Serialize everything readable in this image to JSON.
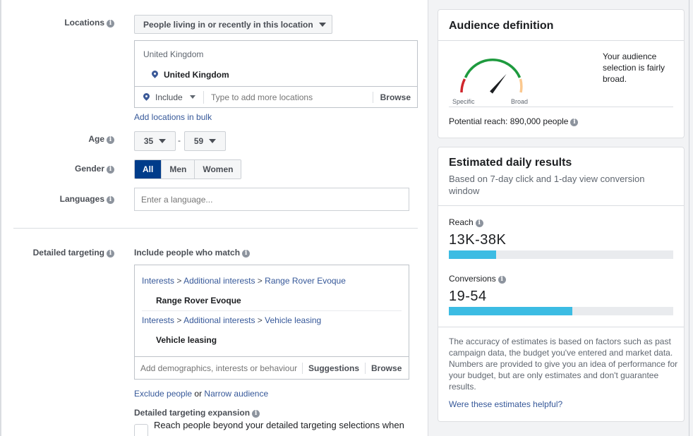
{
  "targeting": {
    "locations": {
      "label": "Locations",
      "mode_dropdown": "People living in or recently in this location",
      "group_header": "United Kingdom",
      "selected": "United Kingdom",
      "include_dropdown": "Include",
      "input_placeholder": "Type to add more locations",
      "browse": "Browse",
      "bulk_link": "Add locations in bulk"
    },
    "age": {
      "label": "Age",
      "min": "35",
      "separator": "-",
      "max": "59"
    },
    "gender": {
      "label": "Gender",
      "options": [
        "All",
        "Men",
        "Women"
      ],
      "selected": "All"
    },
    "languages": {
      "label": "Languages",
      "placeholder": "Enter a language..."
    },
    "detailed": {
      "label": "Detailed targeting",
      "include_label": "Include people who match",
      "items": [
        {
          "path": [
            "Interests",
            "Additional interests",
            "Range Rover Evoque"
          ],
          "name": "Range Rover Evoque"
        },
        {
          "path": [
            "Interests",
            "Additional interests",
            "Vehicle leasing"
          ],
          "name": "Vehicle leasing"
        }
      ],
      "crumb_sep": ">",
      "input_placeholder": "Add demographics, interests or behaviour",
      "suggestions": "Suggestions",
      "browse": "Browse",
      "exclude_link": "Exclude people",
      "or_text": "or",
      "narrow_link": "Narrow audience",
      "expansion_label": "Detailed targeting expansion",
      "expansion_text": "Reach people beyond your detailed targeting selections when"
    }
  },
  "audience": {
    "title": "Audience definition",
    "gauge": {
      "min_label": "Specific",
      "max_label": "Broad",
      "level": 0.72
    },
    "description": "Your audience selection is fairly broad.",
    "potential_reach": "Potential reach: 890,000 people"
  },
  "estimates": {
    "title": "Estimated daily results",
    "subtitle": "Based on 7-day click and 1-day view conversion window",
    "reach": {
      "label": "Reach",
      "value": "13K-38K",
      "fill": 0.21
    },
    "conversions": {
      "label": "Conversions",
      "value": "19-54",
      "fill": 0.55
    },
    "note": "The accuracy of estimates is based on factors such as past campaign data, the budget you've entered and market data. Numbers are provided to give you an idea of performance for your budget, but are only estimates and don't guarantee results.",
    "feedback_link": "Were these estimates helpful?"
  },
  "colors": {
    "accent": "#003c8a",
    "link": "#365899",
    "bar": "#3cbce3",
    "gauge_red": "#d0262c",
    "gauge_green": "#1e9a3e",
    "gauge_orange": "#fbc88f"
  }
}
